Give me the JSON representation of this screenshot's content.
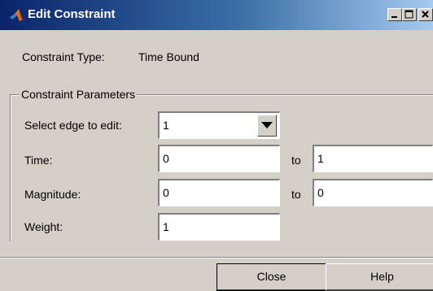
{
  "window": {
    "title": "Edit Constraint",
    "icons": [
      "matlab-logo-icon",
      "minimize-icon",
      "maximize-icon",
      "close-icon"
    ]
  },
  "constraint": {
    "type_label": "Constraint Type:",
    "type_value": "Time Bound"
  },
  "parameters": {
    "group_title": "Constraint Parameters",
    "edge_label": "Select edge to edit:",
    "edge_value": "1",
    "time_label": "Time:",
    "time_from": "0",
    "time_to": "1",
    "magnitude_label": "Magnitude:",
    "magnitude_from": "0",
    "magnitude_to": "0",
    "weight_label": "Weight:",
    "weight_value": "1",
    "to_label": "to"
  },
  "buttons": {
    "close": "Close",
    "help": "Help"
  }
}
